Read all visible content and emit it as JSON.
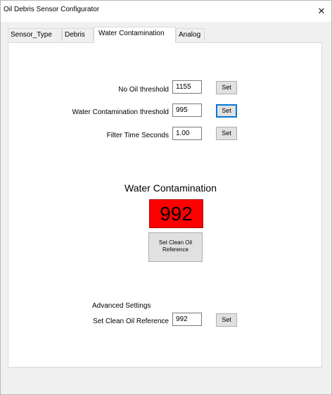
{
  "window": {
    "title": "Oil Debris Sensor Configurator",
    "close_glyph": "✕"
  },
  "tabs": [
    {
      "label": "Sensor_Type",
      "active": false
    },
    {
      "label": "Debris",
      "active": false
    },
    {
      "label": "Water Contamination",
      "active": true
    },
    {
      "label": "Analog",
      "active": false
    }
  ],
  "thresholds": {
    "no_oil": {
      "label": "No Oil threshold",
      "value": "1155",
      "button": "Set"
    },
    "water": {
      "label": "Water Contamination threshold",
      "value": "995",
      "button": "Set"
    },
    "filter": {
      "label": "Filter Time Seconds",
      "value": "1.00",
      "button": "Set"
    }
  },
  "water_contamination": {
    "title": "Water Contamination",
    "value": "992",
    "display_color": "#ff0000",
    "ref_button_line1": "Set Clean Oil",
    "ref_button_line2": "Reference"
  },
  "advanced": {
    "title": "Advanced Settings",
    "label": "Set Clean Oil Reference",
    "value": "992",
    "button": "Set"
  }
}
